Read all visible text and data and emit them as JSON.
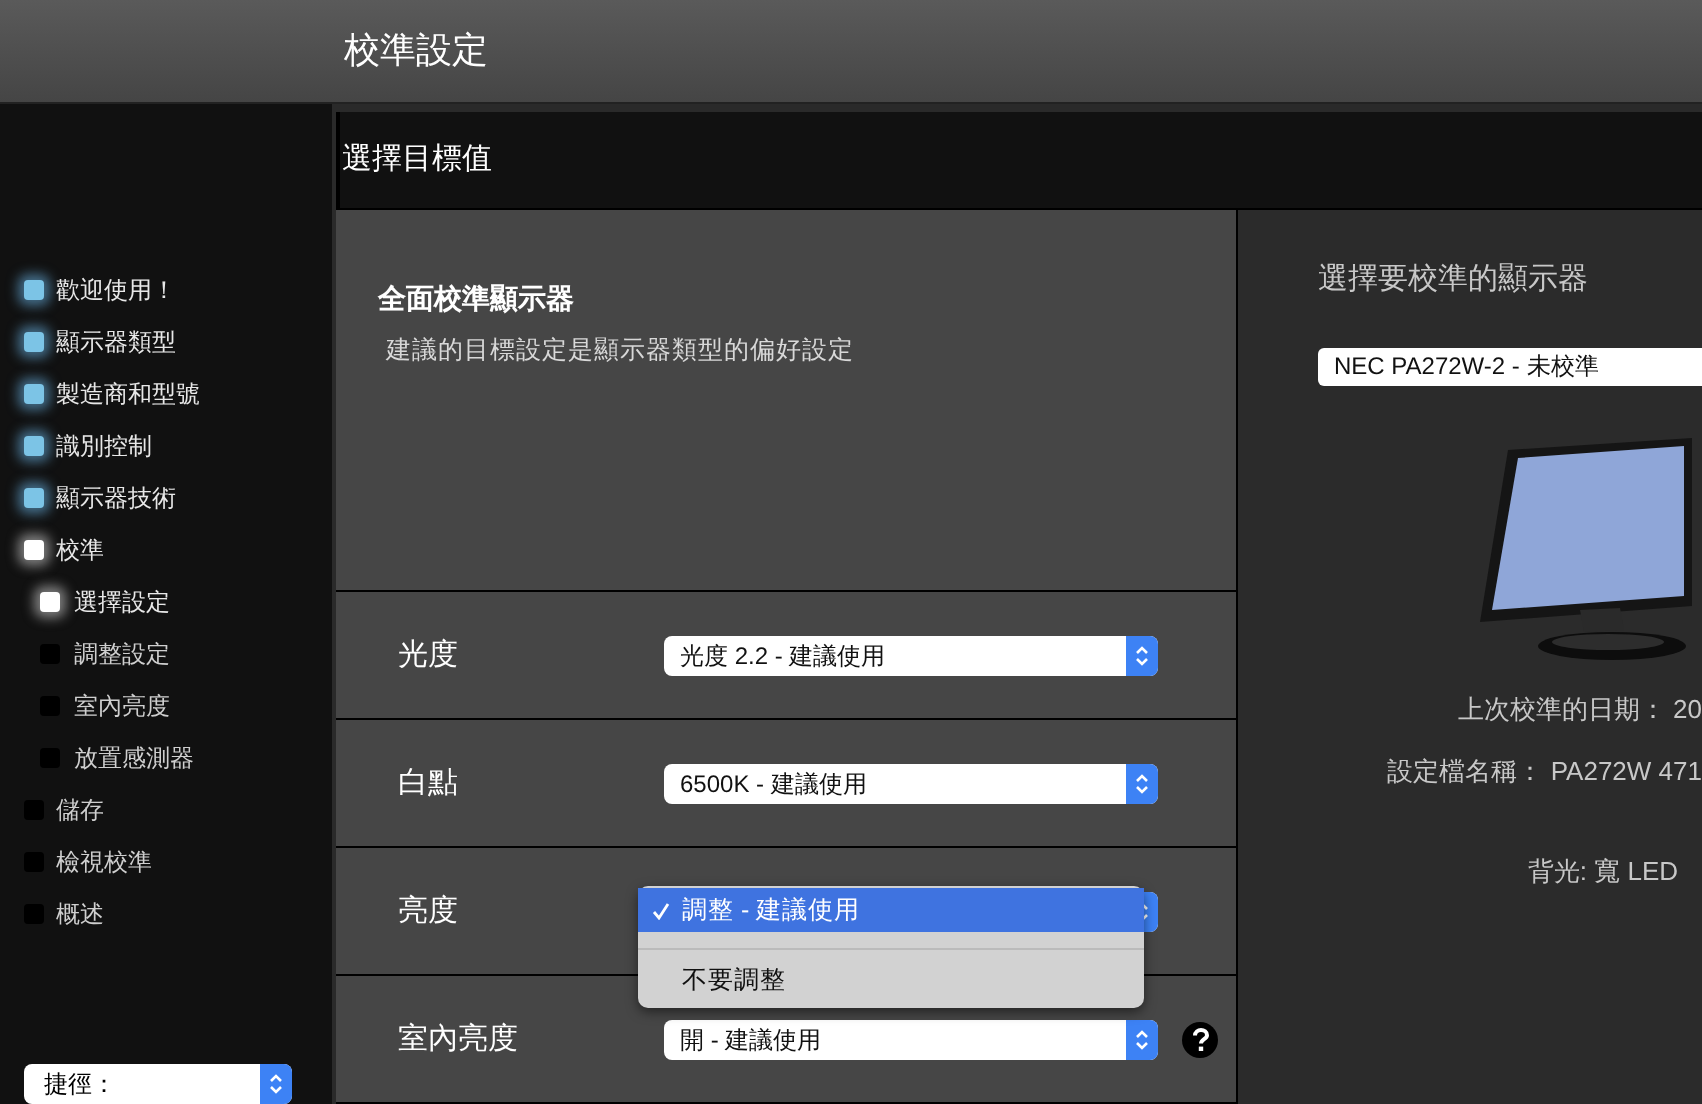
{
  "window": {
    "title": "校準設定"
  },
  "sidebar": {
    "items": [
      {
        "label": "歡迎使用！",
        "completed": true,
        "current": false
      },
      {
        "label": "顯示器類型",
        "completed": true,
        "current": false
      },
      {
        "label": "製造商和型號",
        "completed": true,
        "current": false
      },
      {
        "label": "識別控制",
        "completed": true,
        "current": false
      },
      {
        "label": "顯示器技術",
        "completed": true,
        "current": false
      },
      {
        "label": "校準",
        "completed": false,
        "current": true,
        "children": [
          {
            "label": "選擇設定",
            "completed": false,
            "current": true
          },
          {
            "label": "調整設定",
            "completed": false,
            "current": false
          },
          {
            "label": "室內亮度",
            "completed": false,
            "current": false
          },
          {
            "label": "放置感測器",
            "completed": false,
            "current": false
          }
        ]
      },
      {
        "label": "儲存",
        "completed": false,
        "current": false
      },
      {
        "label": "檢視校準",
        "completed": false,
        "current": false
      },
      {
        "label": "概述",
        "completed": false,
        "current": false
      }
    ],
    "shortcut": {
      "label": "捷徑："
    }
  },
  "panel_title": "選擇目標值",
  "section": {
    "heading": "全面校準顯示器",
    "description": "建議的目標設定是顯示器類型的偏好設定"
  },
  "settings": [
    {
      "label": "光度",
      "value": "光度 2.2 - 建議使用",
      "expanded": false,
      "help": false
    },
    {
      "label": "白點",
      "value": "6500K - 建議使用",
      "expanded": false,
      "help": false
    },
    {
      "label": "亮度",
      "expanded": true,
      "help": false,
      "options": [
        {
          "label": "調整 - 建議使用",
          "selected": true
        },
        {
          "label": "不要調整",
          "selected": false
        }
      ]
    },
    {
      "label": "室內亮度",
      "value": "開 - 建議使用",
      "expanded": false,
      "help": true
    }
  ],
  "display_picker": {
    "title": "選擇要校準的顯示器",
    "selected_display": "NEC PA272W-2 - 未校準"
  },
  "info": [
    "上次校準的日期： 20",
    "設定檔名稱： PA272W 471",
    "背光: 寬 LED"
  ]
}
